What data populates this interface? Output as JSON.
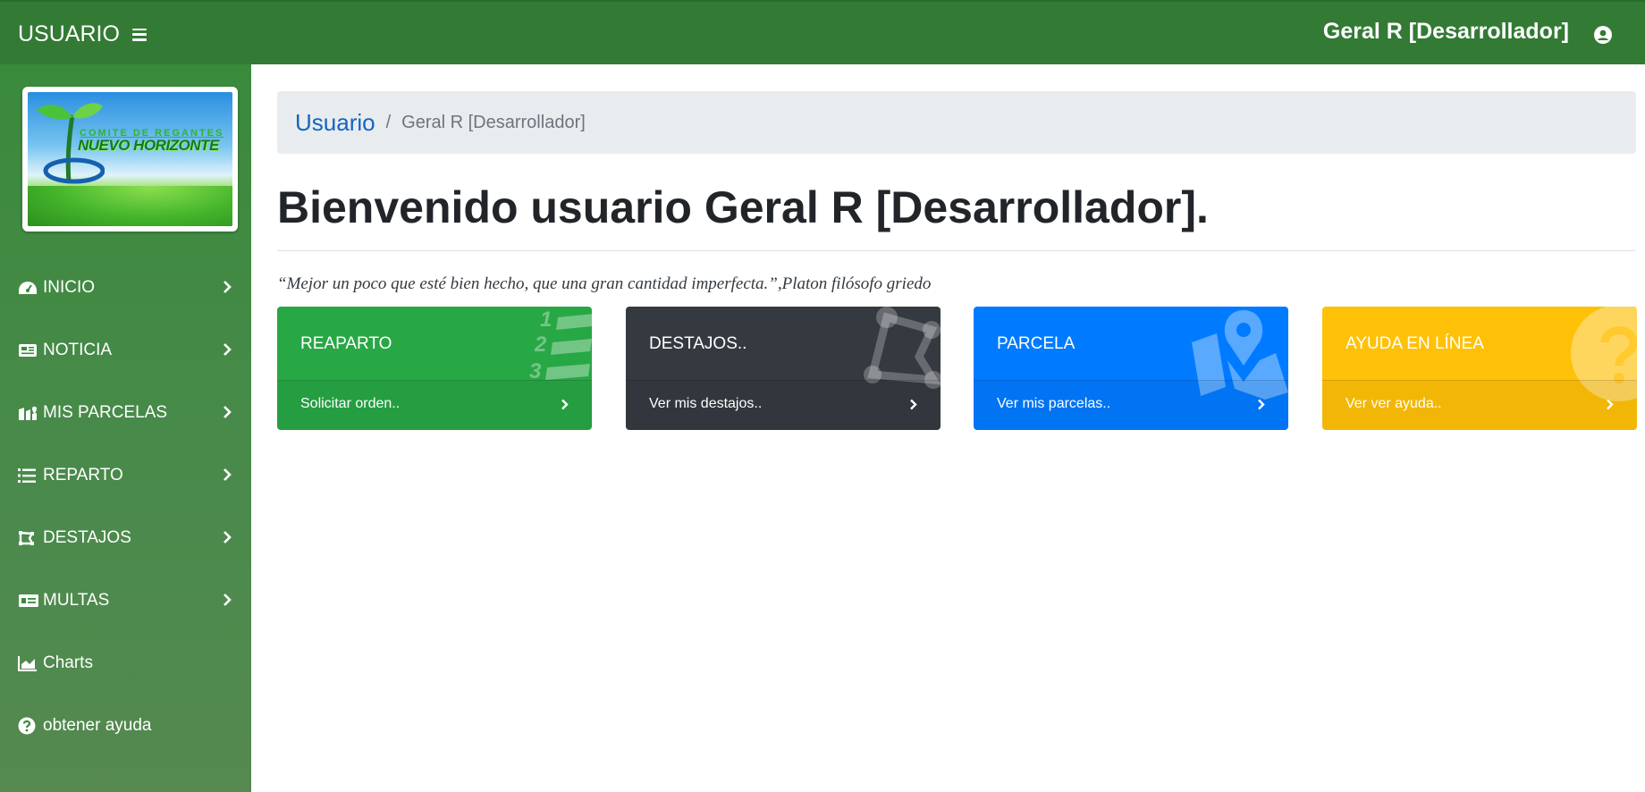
{
  "topbar": {
    "brand": "USUARIO",
    "user_name": "Geral R [Desarrollador]"
  },
  "logo": {
    "line1": "COMITE DE REGANTES",
    "line2": "NUEVO HORIZONTE"
  },
  "sidebar": {
    "items": [
      {
        "label": "INICIO",
        "icon": "dashboard-icon",
        "has_chevron": true
      },
      {
        "label": "NOTICIA",
        "icon": "newspaper-icon",
        "has_chevron": true
      },
      {
        "label": "MIS PARCELAS",
        "icon": "map-marker-icon",
        "has_chevron": true
      },
      {
        "label": "REPARTO",
        "icon": "list-ol-icon",
        "has_chevron": true
      },
      {
        "label": "DESTAJOS",
        "icon": "draw-polygon-icon",
        "has_chevron": true
      },
      {
        "label": "MULTAS",
        "icon": "money-check-icon",
        "has_chevron": true
      },
      {
        "label": "Charts",
        "icon": "chart-area-icon",
        "has_chevron": false
      },
      {
        "label": "obtener ayuda",
        "icon": "question-circle-icon",
        "has_chevron": false
      }
    ]
  },
  "breadcrumb": {
    "link": "Usuario",
    "separator": "/",
    "current": "Geral R [Desarrollador]"
  },
  "main": {
    "title": "Bienvenido usuario Geral R [Desarrollador].",
    "quote": "“Mejor un poco que esté bien hecho, que una gran cantidad imperfecta.”,Platon filósofo griedo"
  },
  "cards": [
    {
      "title": "REAPARTO",
      "link": "Solicitar orden..",
      "color": "#28a745",
      "icon": "list-ol-icon"
    },
    {
      "title": "DESTAJOS..",
      "link": "Ver mis destajos..",
      "color": "#343a40",
      "icon": "draw-polygon-icon"
    },
    {
      "title": "PARCELA",
      "link": "Ver mis parcelas..",
      "color": "#007bff",
      "icon": "map-marked-icon"
    },
    {
      "title": "AYUDA EN LÍNEA",
      "link": "Ver ver ayuda..",
      "color": "#ffc107",
      "icon": "question-circle-icon"
    }
  ]
}
